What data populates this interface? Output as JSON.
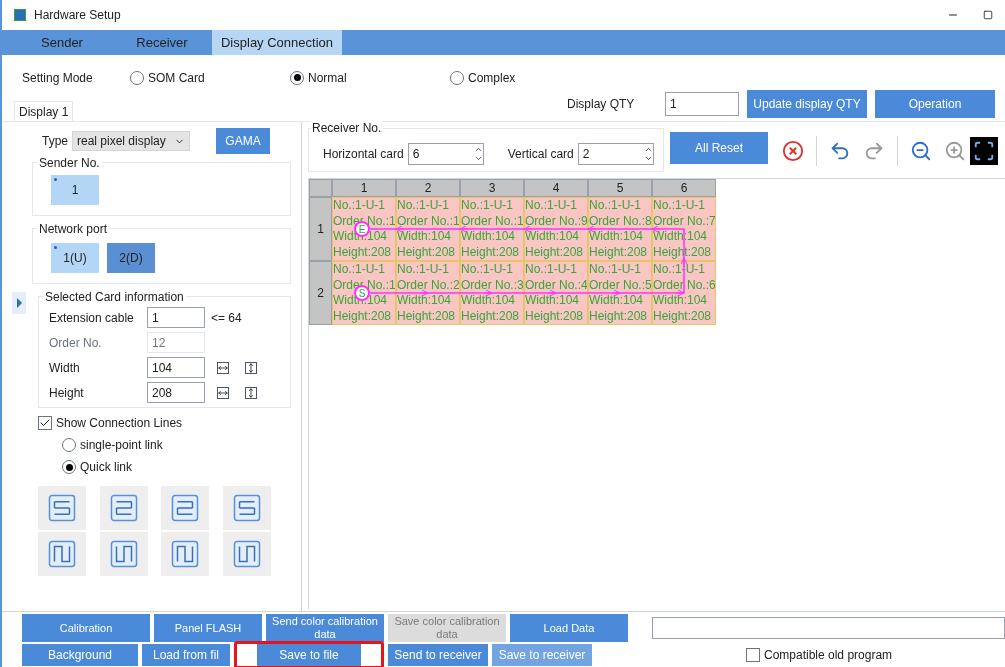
{
  "window": {
    "title": "Hardware Setup"
  },
  "tabs": [
    {
      "label": "Sender",
      "selected": false
    },
    {
      "label": "Receiver",
      "selected": false
    },
    {
      "label": "Display Connection",
      "selected": true
    }
  ],
  "setting_mode": {
    "label": "Setting Mode",
    "options": [
      {
        "label": "SOM Card",
        "selected": false
      },
      {
        "label": "Normal",
        "selected": true
      },
      {
        "label": "Complex",
        "selected": false
      }
    ]
  },
  "display_tabs": [
    {
      "label": "Display 1",
      "selected": true
    }
  ],
  "display_qty": {
    "label": "Display QTY",
    "value": "1",
    "update_button": "Update display QTY",
    "operation_button": "Operation"
  },
  "type": {
    "label": "Type",
    "value": "real pixel display",
    "gama_button": "GAMA"
  },
  "sender_no": {
    "title": "Sender No.",
    "items": [
      {
        "label": "1",
        "selected": false,
        "marked": true
      }
    ]
  },
  "network_port": {
    "title": "Network port",
    "items": [
      {
        "label": "1(U)",
        "selected": false,
        "marked": true
      },
      {
        "label": "2(D)",
        "selected": true,
        "marked": false
      }
    ]
  },
  "card_info": {
    "title": "Selected Card information",
    "fields": [
      {
        "label": "Extension cable",
        "value": "1",
        "disabled": false,
        "hint": "<= 64"
      },
      {
        "label": "Order No.",
        "value": "12",
        "disabled": true
      },
      {
        "label": "Width",
        "value": "104",
        "disabled": false,
        "tools": true
      },
      {
        "label": "Height",
        "value": "208",
        "disabled": false,
        "tools": true
      }
    ]
  },
  "show_lines": {
    "label": "Show Connection Lines",
    "checked": true
  },
  "link_mode": [
    {
      "label": "single-point link",
      "selected": false
    },
    {
      "label": "Quick link",
      "selected": true
    }
  ],
  "receiver_no": {
    "title": "Receiver No.",
    "horizontal_label": "Horizontal card",
    "horizontal_value": "6",
    "vertical_label": "Vertical card",
    "vertical_value": "2"
  },
  "toolbar": {
    "reset_button": "All Reset"
  },
  "grid": {
    "columns": [
      "1",
      "2",
      "3",
      "4",
      "5",
      "6"
    ],
    "rows": [
      {
        "label": "1",
        "cells": [
          [
            "No.:1-U-1",
            "Order No.:1",
            "Width:104",
            "Height:208"
          ],
          [
            "No.:1-U-1",
            "Order No.:1",
            "Width:104",
            "Height:208"
          ],
          [
            "No.:1-U-1",
            "Order No.:1",
            "Width:104",
            "Height:208"
          ],
          [
            "No.:1-U-1",
            "Order No.:9",
            "Width:104",
            "Height:208"
          ],
          [
            "No.:1-U-1",
            "Order No.:8",
            "Width:104",
            "Height:208"
          ],
          [
            "No.:1-U-1",
            "Order No.:7",
            "Width:104",
            "Height:208"
          ]
        ]
      },
      {
        "label": "2",
        "cells": [
          [
            "No.:1-U-1",
            "Order No.:1",
            "Width:104",
            "Height:208"
          ],
          [
            "No.:1-U-1",
            "Order No.:2",
            "Width:104",
            "Height:208"
          ],
          [
            "No.:1-U-1",
            "Order No.:3",
            "Width:104",
            "Height:208"
          ],
          [
            "No.:1-U-1",
            "Order No.:4",
            "Width:104",
            "Height:208"
          ],
          [
            "No.:1-U-1",
            "Order No.:5",
            "Width:104",
            "Height:208"
          ],
          [
            "No.:1-U-1",
            "Order No.:6",
            "Width:104",
            "Height:208"
          ]
        ]
      }
    ],
    "start_label": "S",
    "end_label": "E"
  },
  "bottom_row1": [
    {
      "label": "Calibration",
      "disabled": false
    },
    {
      "label": "Panel FLASH",
      "disabled": false
    },
    {
      "label": "Send color calibration data",
      "disabled": false
    },
    {
      "label": "Save color calibration data",
      "disabled": true
    },
    {
      "label": "Load Data",
      "disabled": false
    }
  ],
  "bottom_row2": [
    {
      "label": "Background",
      "highlighted": false
    },
    {
      "label": "Load from fil",
      "highlighted": false
    },
    {
      "label": "Save to file",
      "highlighted": true
    },
    {
      "label": "Send to receiver",
      "highlighted": false
    },
    {
      "label": "Save to receiver",
      "highlighted": false
    }
  ],
  "compatible": {
    "label": "Compatible old program",
    "checked": false
  }
}
